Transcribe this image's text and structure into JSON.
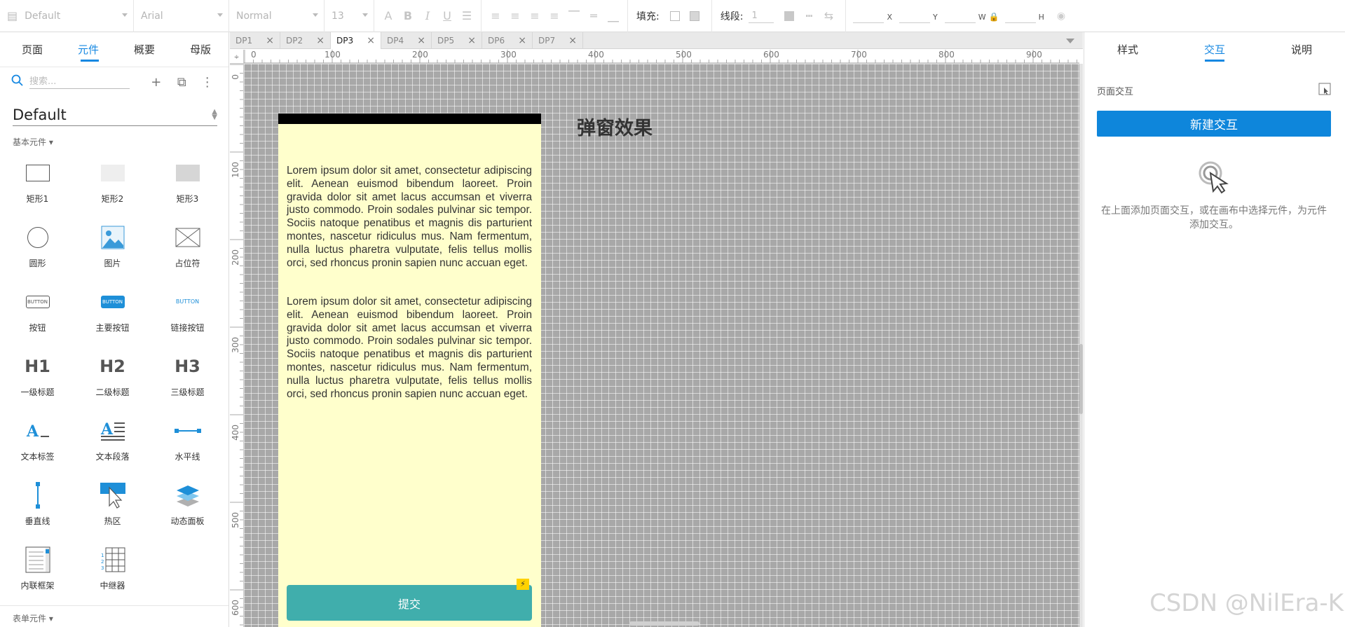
{
  "toolbar": {
    "style_select": "Default",
    "font_select": "Arial",
    "weight_select": "Normal",
    "size_select": "13",
    "fill_label": "填充:",
    "line_label": "线段:",
    "line_value": "1",
    "x_label": "X",
    "y_label": "Y",
    "w_label": "W",
    "h_label": "H"
  },
  "left_panel": {
    "tabs": [
      "页面",
      "元件",
      "概要",
      "母版"
    ],
    "active_tab": "元件",
    "search_placeholder": "搜索...",
    "library": "Default",
    "section_basic": "基本元件 ▾",
    "section_form": "表单元件 ▾",
    "widgets": [
      {
        "label": "矩形1",
        "icon": "rectangle-icon"
      },
      {
        "label": "矩形2",
        "icon": "rectangle-light-icon"
      },
      {
        "label": "矩形3",
        "icon": "rectangle-gray-icon"
      },
      {
        "label": "圆形",
        "icon": "circle-icon"
      },
      {
        "label": "图片",
        "icon": "image-icon"
      },
      {
        "label": "占位符",
        "icon": "placeholder-icon"
      },
      {
        "label": "按钮",
        "icon": "button-icon",
        "icon_text": "BUTTON"
      },
      {
        "label": "主要按钮",
        "icon": "primary-button-icon",
        "icon_text": "BUTTON"
      },
      {
        "label": "链接按钮",
        "icon": "link-button-icon",
        "icon_text": "BUTTON"
      },
      {
        "label": "一级标题",
        "icon": "h1-icon",
        "icon_text": "H1"
      },
      {
        "label": "二级标题",
        "icon": "h2-icon",
        "icon_text": "H2"
      },
      {
        "label": "三级标题",
        "icon": "h3-icon",
        "icon_text": "H3"
      },
      {
        "label": "文本标签",
        "icon": "text-label-icon"
      },
      {
        "label": "文本段落",
        "icon": "text-paragraph-icon"
      },
      {
        "label": "水平线",
        "icon": "horizontal-line-icon"
      },
      {
        "label": "垂直线",
        "icon": "vertical-line-icon"
      },
      {
        "label": "热区",
        "icon": "hotspot-icon"
      },
      {
        "label": "动态面板",
        "icon": "dynamic-panel-icon"
      },
      {
        "label": "内联框架",
        "icon": "inline-frame-icon"
      },
      {
        "label": "中继器",
        "icon": "repeater-icon"
      }
    ]
  },
  "doc_tabs": [
    "DP1",
    "DP2",
    "DP3",
    "DP4",
    "DP5",
    "DP6",
    "DP7"
  ],
  "active_doc_tab": "DP3",
  "ruler": {
    "h_ticks": [
      "0",
      "100",
      "200",
      "300",
      "400",
      "500",
      "600",
      "700",
      "800",
      "900"
    ],
    "v_ticks": [
      "0",
      "100",
      "200",
      "300",
      "400",
      "500",
      "600"
    ]
  },
  "canvas": {
    "title": "弹窗效果",
    "paragraph1": "Lorem ipsum dolor sit amet, consectetur adipiscing elit. Aenean euismod bibendum laoreet. Proin gravida dolor sit amet lacus accumsan et viverra justo commodo. Proin sodales pulvinar sic tempor. Sociis natoque penatibus et magnis dis parturient montes, nascetur ridiculus mus. Nam fermentum, nulla luctus pharetra vulputate, felis tellus mollis orci, sed rhoncus pronin sapien nunc accuan eget.",
    "paragraph2": "Lorem ipsum dolor sit amet, consectetur adipiscing elit. Aenean euismod bibendum laoreet. Proin gravida dolor sit amet lacus accumsan et viverra justo commodo. Proin sodales pulvinar sic tempor. Sociis natoque penatibus et magnis dis parturient montes, nascetur ridiculus mus. Nam fermentum, nulla luctus pharetra vulputate, felis tellus mollis orci, sed rhoncus pronin sapien nunc accuan eget.",
    "submit_label": "提交",
    "phone_bg": "#ffffcc",
    "button_color": "#40aeac"
  },
  "right_panel": {
    "tabs": [
      "样式",
      "交互",
      "说明"
    ],
    "active_tab": "交互",
    "section_label": "页面交互",
    "new_button": "新建交互",
    "hint": "在上面添加页面交互，或在画布中选择元件，为元件添加交互。",
    "accent": "#0e86db"
  },
  "watermark": "CSDN @NilEra-K"
}
